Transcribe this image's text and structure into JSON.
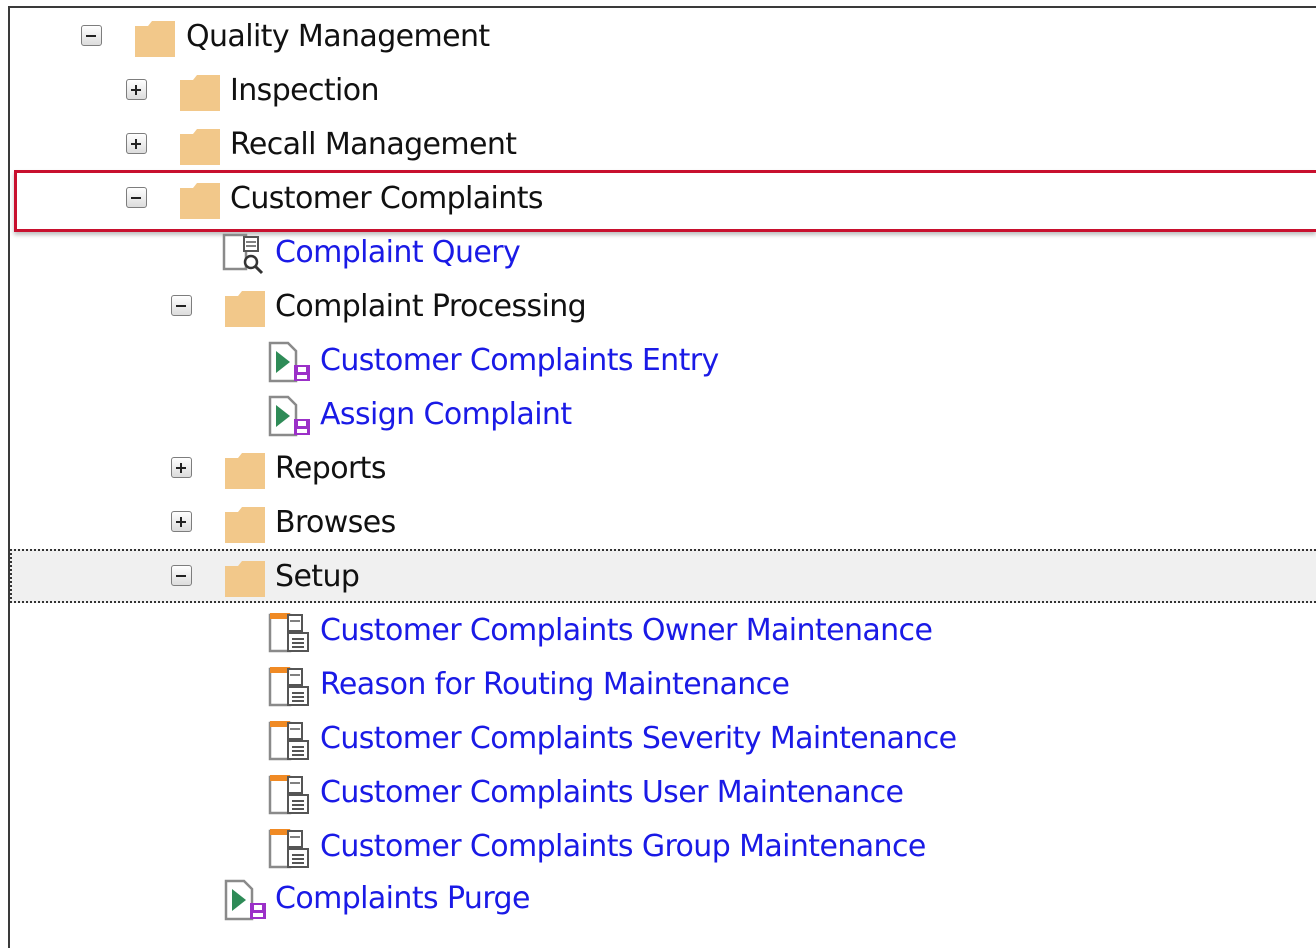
{
  "tree": {
    "quality_management": "Quality Management",
    "inspection": "Inspection",
    "recall_management": "Recall Management",
    "customer_complaints": "Customer Complaints",
    "complaint_query": "Complaint Query",
    "complaint_processing": "Complaint Processing",
    "customer_complaints_entry": "Customer Complaints Entry",
    "assign_complaint": "Assign Complaint",
    "reports": "Reports",
    "browses": "Browses",
    "setup": "Setup",
    "owner_maintenance": "Customer Complaints Owner Maintenance",
    "routing_maintenance": "Reason for Routing Maintenance",
    "severity_maintenance": "Customer Complaints Severity Maintenance",
    "user_maintenance": "Customer Complaints User Maintenance",
    "group_maintenance": "Customer Complaints Group Maintenance",
    "complaints_purge": "Complaints Purge"
  },
  "colors": {
    "folder": "#f2c88a",
    "link_text": "#1a1ae6",
    "highlight_border": "#c8102e",
    "program_arrow": "#2e8b57",
    "program_save": "#9b30c8",
    "maintenance_tab": "#f08a24"
  },
  "icons": {
    "expanded": "minus-box-icon",
    "collapsed": "plus-box-icon",
    "folder": "folder-icon",
    "query": "query-icon",
    "program": "program-icon",
    "maintenance": "maintenance-icon"
  }
}
